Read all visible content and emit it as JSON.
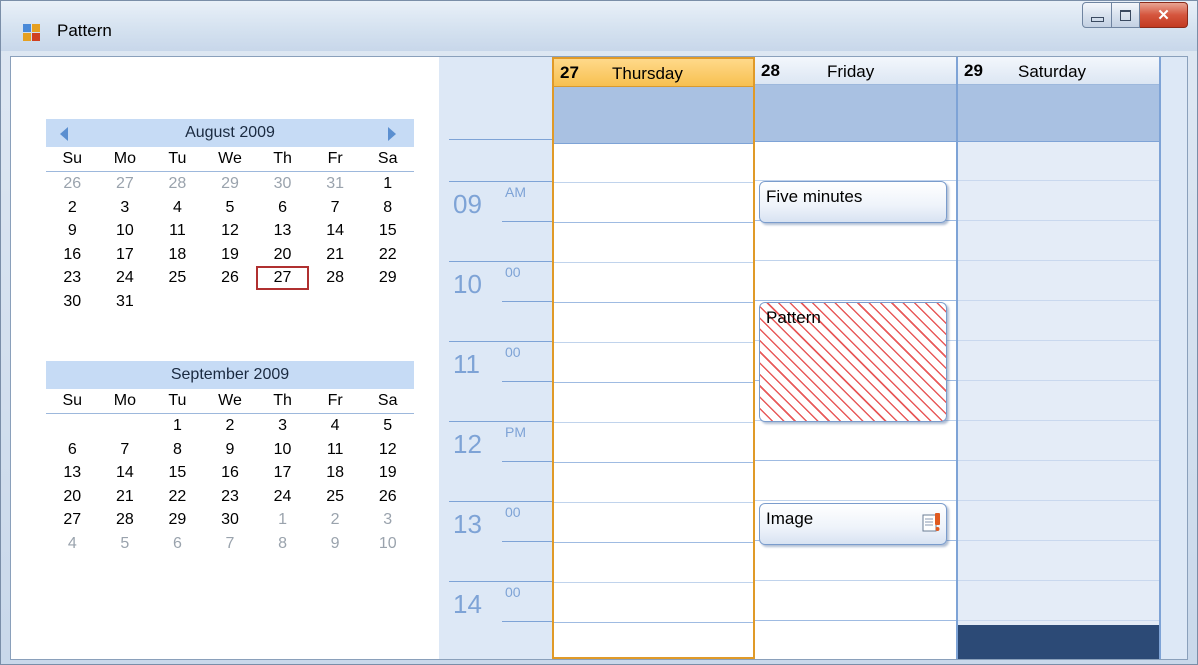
{
  "window": {
    "title": "Pattern"
  },
  "calendar": {
    "months": [
      {
        "title": "August 2009",
        "dow": [
          "Su",
          "Mo",
          "Tu",
          "We",
          "Th",
          "Fr",
          "Sa"
        ],
        "days": [
          {
            "d": "26",
            "o": true
          },
          {
            "d": "27",
            "o": true
          },
          {
            "d": "28",
            "o": true
          },
          {
            "d": "29",
            "o": true
          },
          {
            "d": "30",
            "o": true
          },
          {
            "d": "31",
            "o": true
          },
          {
            "d": "1",
            "o": false
          },
          {
            "d": "2",
            "o": false
          },
          {
            "d": "3",
            "o": false
          },
          {
            "d": "4",
            "o": false
          },
          {
            "d": "5",
            "o": false
          },
          {
            "d": "6",
            "o": false
          },
          {
            "d": "7",
            "o": false
          },
          {
            "d": "8",
            "o": false
          },
          {
            "d": "9",
            "o": false
          },
          {
            "d": "10",
            "o": false
          },
          {
            "d": "11",
            "o": false
          },
          {
            "d": "12",
            "o": false
          },
          {
            "d": "13",
            "o": false
          },
          {
            "d": "14",
            "o": false
          },
          {
            "d": "15",
            "o": false
          },
          {
            "d": "16",
            "o": false
          },
          {
            "d": "17",
            "o": false
          },
          {
            "d": "18",
            "o": false
          },
          {
            "d": "19",
            "o": false
          },
          {
            "d": "20",
            "o": false
          },
          {
            "d": "21",
            "o": false
          },
          {
            "d": "22",
            "o": false
          },
          {
            "d": "23",
            "o": false
          },
          {
            "d": "24",
            "o": false
          },
          {
            "d": "25",
            "o": false
          },
          {
            "d": "26",
            "o": false
          },
          {
            "d": "27",
            "o": false,
            "today": true
          },
          {
            "d": "28",
            "o": false
          },
          {
            "d": "29",
            "o": false
          },
          {
            "d": "30",
            "o": false
          },
          {
            "d": "31",
            "o": false
          }
        ]
      },
      {
        "title": "September 2009",
        "dow": [
          "Su",
          "Mo",
          "Tu",
          "We",
          "Th",
          "Fr",
          "Sa"
        ],
        "days": [
          {
            "d": "",
            "o": false
          },
          {
            "d": "",
            "o": false
          },
          {
            "d": "1",
            "o": false
          },
          {
            "d": "2",
            "o": false
          },
          {
            "d": "3",
            "o": false
          },
          {
            "d": "4",
            "o": false
          },
          {
            "d": "5",
            "o": false
          },
          {
            "d": "6",
            "o": false
          },
          {
            "d": "7",
            "o": false
          },
          {
            "d": "8",
            "o": false
          },
          {
            "d": "9",
            "o": false
          },
          {
            "d": "10",
            "o": false
          },
          {
            "d": "11",
            "o": false
          },
          {
            "d": "12",
            "o": false
          },
          {
            "d": "13",
            "o": false
          },
          {
            "d": "14",
            "o": false
          },
          {
            "d": "15",
            "o": false
          },
          {
            "d": "16",
            "o": false
          },
          {
            "d": "17",
            "o": false
          },
          {
            "d": "18",
            "o": false
          },
          {
            "d": "19",
            "o": false
          },
          {
            "d": "20",
            "o": false
          },
          {
            "d": "21",
            "o": false
          },
          {
            "d": "22",
            "o": false
          },
          {
            "d": "23",
            "o": false
          },
          {
            "d": "24",
            "o": false
          },
          {
            "d": "25",
            "o": false
          },
          {
            "d": "26",
            "o": false
          },
          {
            "d": "27",
            "o": false
          },
          {
            "d": "28",
            "o": false
          },
          {
            "d": "29",
            "o": false
          },
          {
            "d": "30",
            "o": false
          },
          {
            "d": "1",
            "o": true
          },
          {
            "d": "2",
            "o": true
          },
          {
            "d": "3",
            "o": true
          },
          {
            "d": "4",
            "o": true
          },
          {
            "d": "5",
            "o": true
          },
          {
            "d": "6",
            "o": true
          },
          {
            "d": "7",
            "o": true
          },
          {
            "d": "8",
            "o": true
          },
          {
            "d": "9",
            "o": true
          },
          {
            "d": "10",
            "o": true
          }
        ]
      }
    ]
  },
  "schedule": {
    "times": [
      {
        "hour": "09",
        "suffix": "AM"
      },
      {
        "hour": "10",
        "suffix": "00"
      },
      {
        "hour": "11",
        "suffix": "00"
      },
      {
        "hour": "12",
        "suffix": "PM"
      },
      {
        "hour": "13",
        "suffix": "00"
      },
      {
        "hour": "14",
        "suffix": "00"
      }
    ],
    "days": [
      {
        "num": "27",
        "name": "Thursday"
      },
      {
        "num": "28",
        "name": "Friday"
      },
      {
        "num": "29",
        "name": "Saturday"
      }
    ],
    "appointments": {
      "five_minutes": "Five minutes",
      "pattern": "Pattern",
      "image": "Image"
    }
  },
  "colors": {
    "accent_today": "#e09a28",
    "grid_line": "#7ea3d6",
    "pattern_stripe": "#e85a5a",
    "selection_fill": "#2c4a76"
  }
}
